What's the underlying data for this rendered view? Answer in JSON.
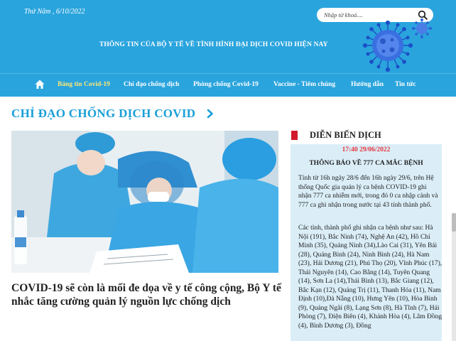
{
  "header": {
    "date": "Thứ Năm , 6/10/2022",
    "search_placeholder": "Nhập từ khoá....",
    "banner": "THÔNG TIN CỦA BỘ Y TẾ VỀ TÌNH HÌNH ĐẠI DỊCH COVID HIỆN NAY"
  },
  "nav": {
    "items": [
      {
        "label": "Bảng tin Covid-19",
        "active": true
      },
      {
        "label": "Chỉ đạo chống dịch"
      },
      {
        "label": "Phòng chống Covid-19"
      },
      {
        "label": "Vaccine - Tiêm chủng"
      },
      {
        "label": "Hướng dẫn"
      },
      {
        "label": "Tin tức"
      }
    ]
  },
  "section": {
    "title": "CHỈ ĐẠO CHỐNG DỊCH COVID"
  },
  "article": {
    "headline": "COVID-19 sẽ còn là mối đe dọa về y tế công cộng, Bộ Y tế nhắc tăng cường quản lý nguồn lực chống dịch"
  },
  "sidebar": {
    "title": "DIỄN BIẾN DỊCH",
    "time": "17:40 29/06/2022",
    "notice_title": "THÔNG BÁO VỀ 777 CA MẮC BỆNH",
    "paragraph1": "Tính từ 16h ngày 28/6 đến 16h ngày 29/6, trên Hệ thống Quốc gia quản lý ca bệnh COVID-19 ghi nhận 777 ca nhiễm mới, trong đó 0 ca nhập cảnh và 777 ca ghi nhận trong nước tại 43 tỉnh thành phố.",
    "paragraph2": "Các tỉnh, thành phố ghi nhận ca bệnh như sau: Hà Nội (191), Bắc Ninh (74), Nghệ An (42), Hồ Chí Minh (35), Quảng Ninh (34),Lào Cai (31), Yên Bái (28), Quảng Bình (24), Ninh Bình (24), Hà Nam (23), Hải Dương (21), Phú Thọ (20), Vĩnh Phúc (17), Thái Nguyên (14), Cao Bằng (14), Tuyên Quang (14), Sơn La (14),Thái Bình (13), Bắc Giang (12), Bắc Kạn (12), Quảng Trị (11), Thanh Hóa (11), Nam Định (10),Đà Nẵng (10), Hưng Yên (10), Hòa Bình (9), Quảng Ngãi (8), Lạng Sơn (8), Hà Tĩnh (7), Hải Phòng (7), Điện Biên (4), Khánh Hòa (4), Lâm Đồng (4), Bình Dương (3), Đồng"
  },
  "colors": {
    "header_bg": "#2aa4dd",
    "nav_active": "#ffe873",
    "section_title": "#1a9fd8",
    "sidebar_marker": "#d2192b",
    "sidebar_bg": "#dbeef8",
    "time_red": "#e5333a"
  },
  "icons": [
    "home-icon",
    "search-icon",
    "chevron-right-icon",
    "virus-graphic"
  ]
}
